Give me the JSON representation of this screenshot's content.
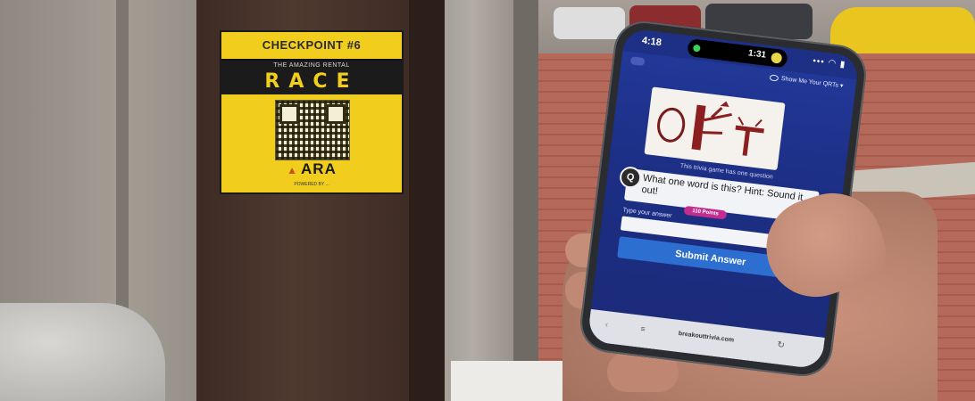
{
  "poster": {
    "checkpoint": "CHECKPOINT #6",
    "subtitle": "THE AMAZING RENTAL",
    "race": "RACE",
    "brand": "ARA",
    "footer": "POWERED BY ..."
  },
  "phone": {
    "status_time": "4:18",
    "island_time": "1:31",
    "status_icons": "••• ◠ ▮",
    "topbar_link": "Show Me Your QRTs",
    "caption": "This trivia game has one question",
    "question_badge": "Q",
    "question": "What one word is this? Hint: Sound it out!",
    "points": "110 Points",
    "answer_label": "Type your answer",
    "answer_placeholder": "",
    "submit_label": "Submit Answer",
    "url": "breakouttrivia.com",
    "back_icon": "‹",
    "reader_icon": "≡",
    "reload_icon": "↻"
  },
  "colors": {
    "screen_bg": "#1d2f86",
    "submit_bg": "#2c6fd1",
    "points_badge": "#c22d8f",
    "poster_yellow": "#f1ce1d"
  },
  "icons": [
    "eye-icon",
    "toggle-switch-icon",
    "back-arrow-icon",
    "reader-icon",
    "reload-icon",
    "wifi-icon",
    "battery-icon"
  ]
}
